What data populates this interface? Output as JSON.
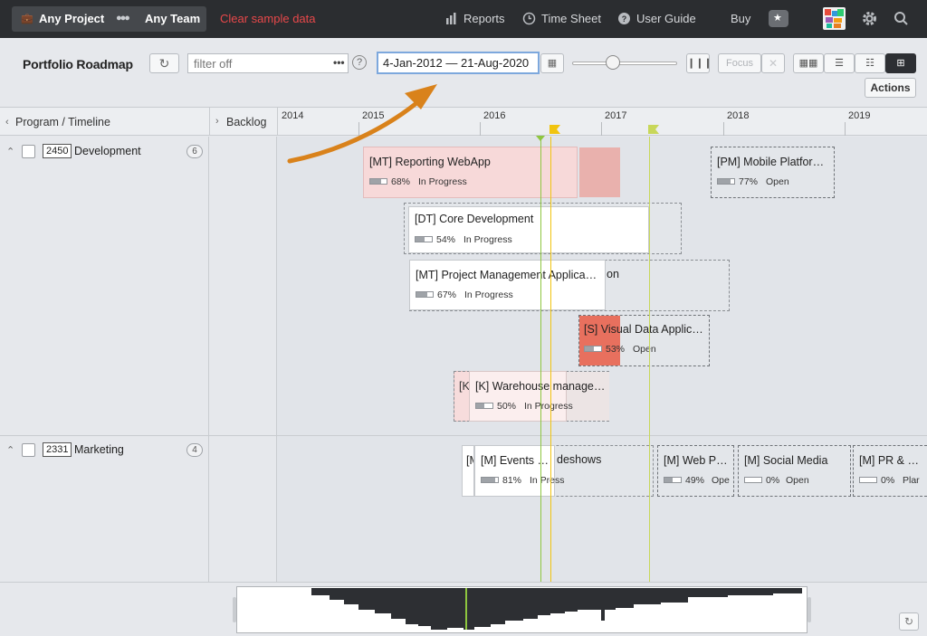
{
  "topbar": {
    "project_filter": "Any Project",
    "team_filter": "Any Team",
    "clear_sample": "Clear sample data",
    "reports": "Reports",
    "timesheet": "Time Sheet",
    "user_guide": "User Guide",
    "buy": "Buy"
  },
  "toolbar": {
    "title": "Portfolio Roadmap",
    "filter_placeholder": "filter off",
    "filter_dots": "•••",
    "help": "?",
    "date_range": "4-Jan-2012 — 21-Aug-2020",
    "focus_label": "Focus",
    "actions_label": "Actions",
    "zoom_level": 0.35
  },
  "grid": {
    "program_header": "Program / Timeline",
    "backlog_header": "Backlog",
    "years": [
      "2014",
      "2015",
      "2016",
      "2017",
      "2018",
      "2019"
    ]
  },
  "programs": [
    {
      "id": "2450",
      "name": "Development",
      "count": "6",
      "items": [
        {
          "title": "[MT] Reporting WebApp",
          "pct": "68%",
          "status": "In Progress",
          "progress": 0.68
        },
        {
          "title": "[PM] Mobile Platfor…",
          "pct": "77%",
          "status": "Open",
          "progress": 0.77
        },
        {
          "title": "[DT] Core Development",
          "pct": "54%",
          "status": "In Progress",
          "progress": 0.54
        },
        {
          "title": "[MT] Project Management Applica…",
          "title_tail": "on",
          "pct": "67%",
          "status": "In Progress",
          "progress": 0.67
        },
        {
          "title": "[S] Visual Data Applic…",
          "pct": "53%",
          "status": "Open",
          "progress": 0.53
        },
        {
          "title": "[K] Warehouse manage…",
          "prefix": "[K",
          "pct": "50%",
          "status": "In Progress",
          "progress": 0.5
        }
      ]
    },
    {
      "id": "2331",
      "name": "Marketing",
      "count": "4",
      "items": [
        {
          "title": "[M] Events …",
          "title_tail": "deshows",
          "prefix": "[M",
          "pct": "81%",
          "status": "In Press",
          "progress": 0.81
        },
        {
          "title": "[M] Web P…",
          "pct": "49%",
          "status": "Ope",
          "progress": 0.49
        },
        {
          "title": "[M] Social Media",
          "pct": "0%",
          "status": "Open",
          "progress": 0
        },
        {
          "title": "[M] PR & …",
          "pct": "0%",
          "status": "Plar",
          "progress": 0
        }
      ]
    }
  ],
  "colors": {
    "topbar": "#2b2d30",
    "clear_link": "#e8484a",
    "today_line": "#8ec63f",
    "milestone_yellow": "#f1c40f",
    "milestone_green": "#c8d75a",
    "overdue_pink": "#f6d6d6",
    "overdue_red": "#e8705e",
    "arrow": "#d9821b"
  },
  "icons": {
    "project": "briefcase-icon",
    "team": "team-icon",
    "reports": "bar-chart-icon",
    "timesheet": "clock-icon",
    "guide": "help-circle-icon",
    "buy": "star-chat-icon",
    "settings": "gear-icon",
    "search": "search-icon"
  }
}
